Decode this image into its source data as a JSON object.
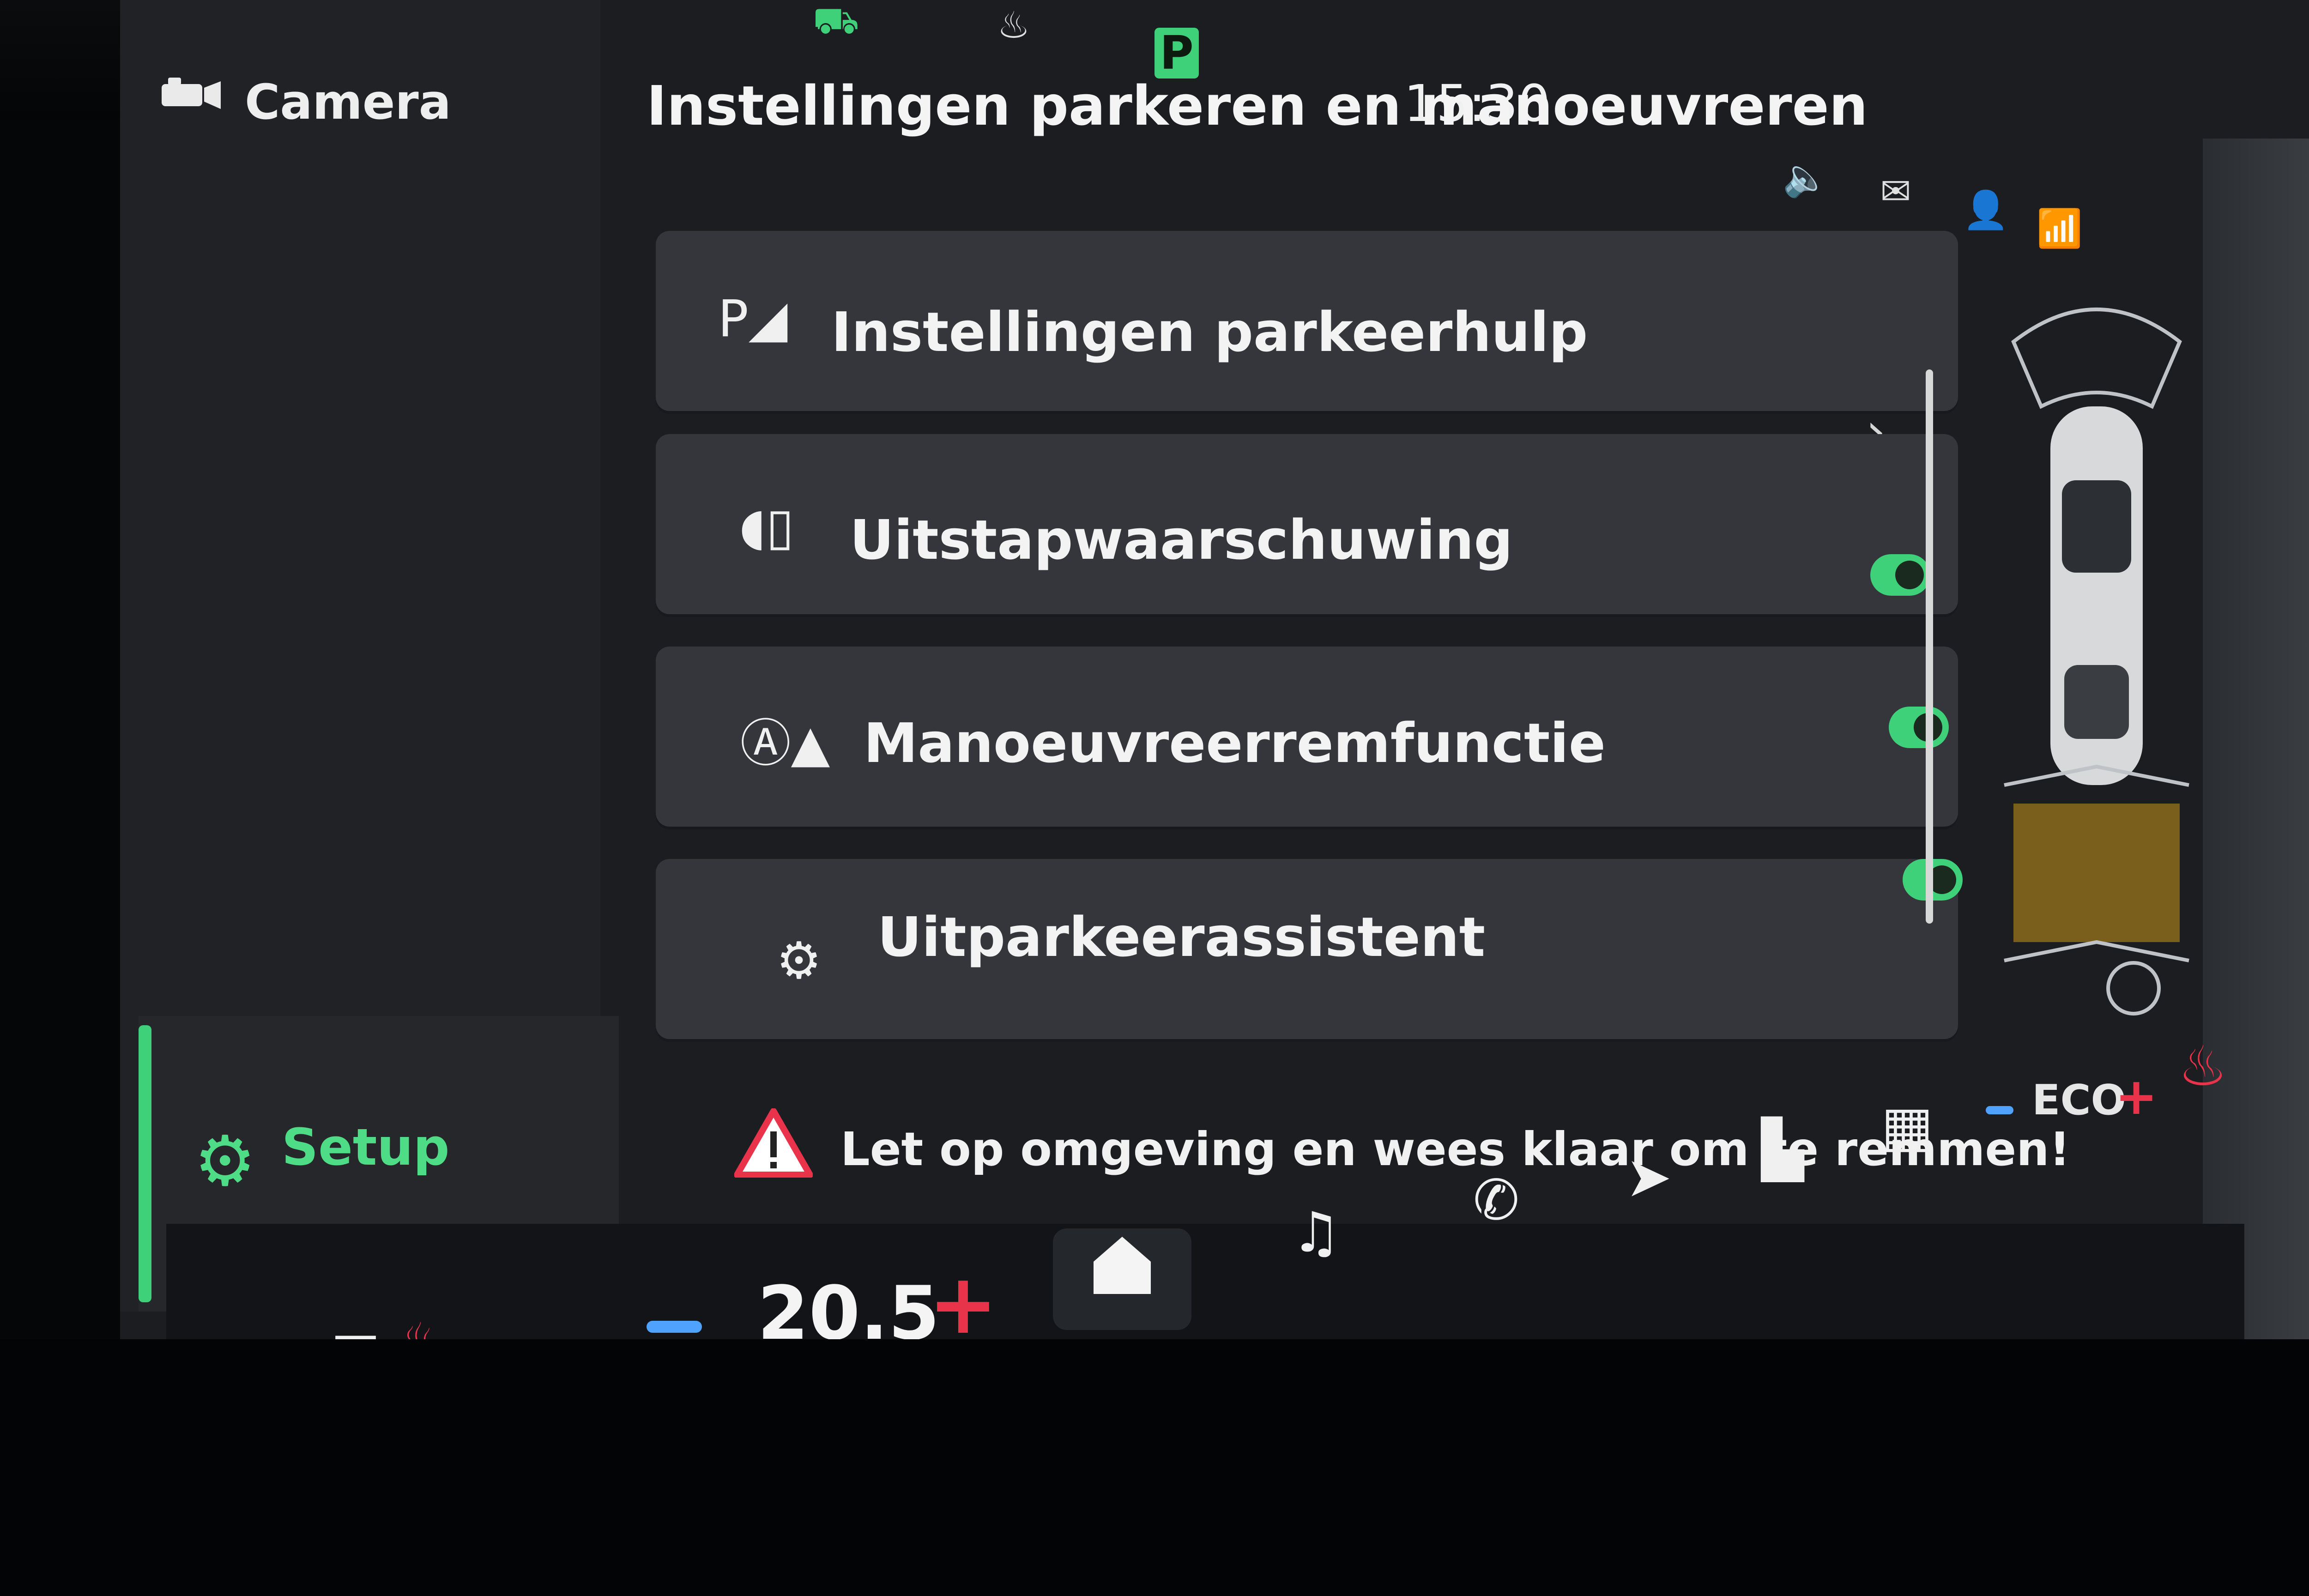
{
  "sidebar": {
    "camera_label": "Camera",
    "setup_label": "Setup"
  },
  "header": {
    "title": "Instellingen parkeren en manoeuvreren",
    "time": "15:30",
    "gear_indicator": "P"
  },
  "settings_rows": [
    {
      "label": "Instellingen parkeerhulp",
      "icon": "parking-sensor-icon",
      "control": "chevron"
    },
    {
      "label": "Uitstapwaarschuwing",
      "icon": "exit-warning-icon",
      "control": "toggle",
      "enabled": true
    },
    {
      "label": "Manoeuvreerremfunctie",
      "icon": "maneuver-brake-icon",
      "control": "toggle",
      "enabled": true
    },
    {
      "label": "Uitparkeerassistent",
      "icon": "park-out-assist-icon",
      "control": "toggle",
      "enabled": true
    }
  ],
  "warning": {
    "text": "Let op omgeving en wees klaar om te remmen!"
  },
  "climate": {
    "temperature": "20.5",
    "minus_label": "−",
    "plus_label": "+"
  },
  "drive_mode": {
    "label": "ECO",
    "plus_label": "+"
  },
  "colors": {
    "accent_green": "#3fd07a",
    "warning_red": "#e8334b",
    "minus_blue": "#4fa3ff",
    "row_bg": "#34363b"
  }
}
